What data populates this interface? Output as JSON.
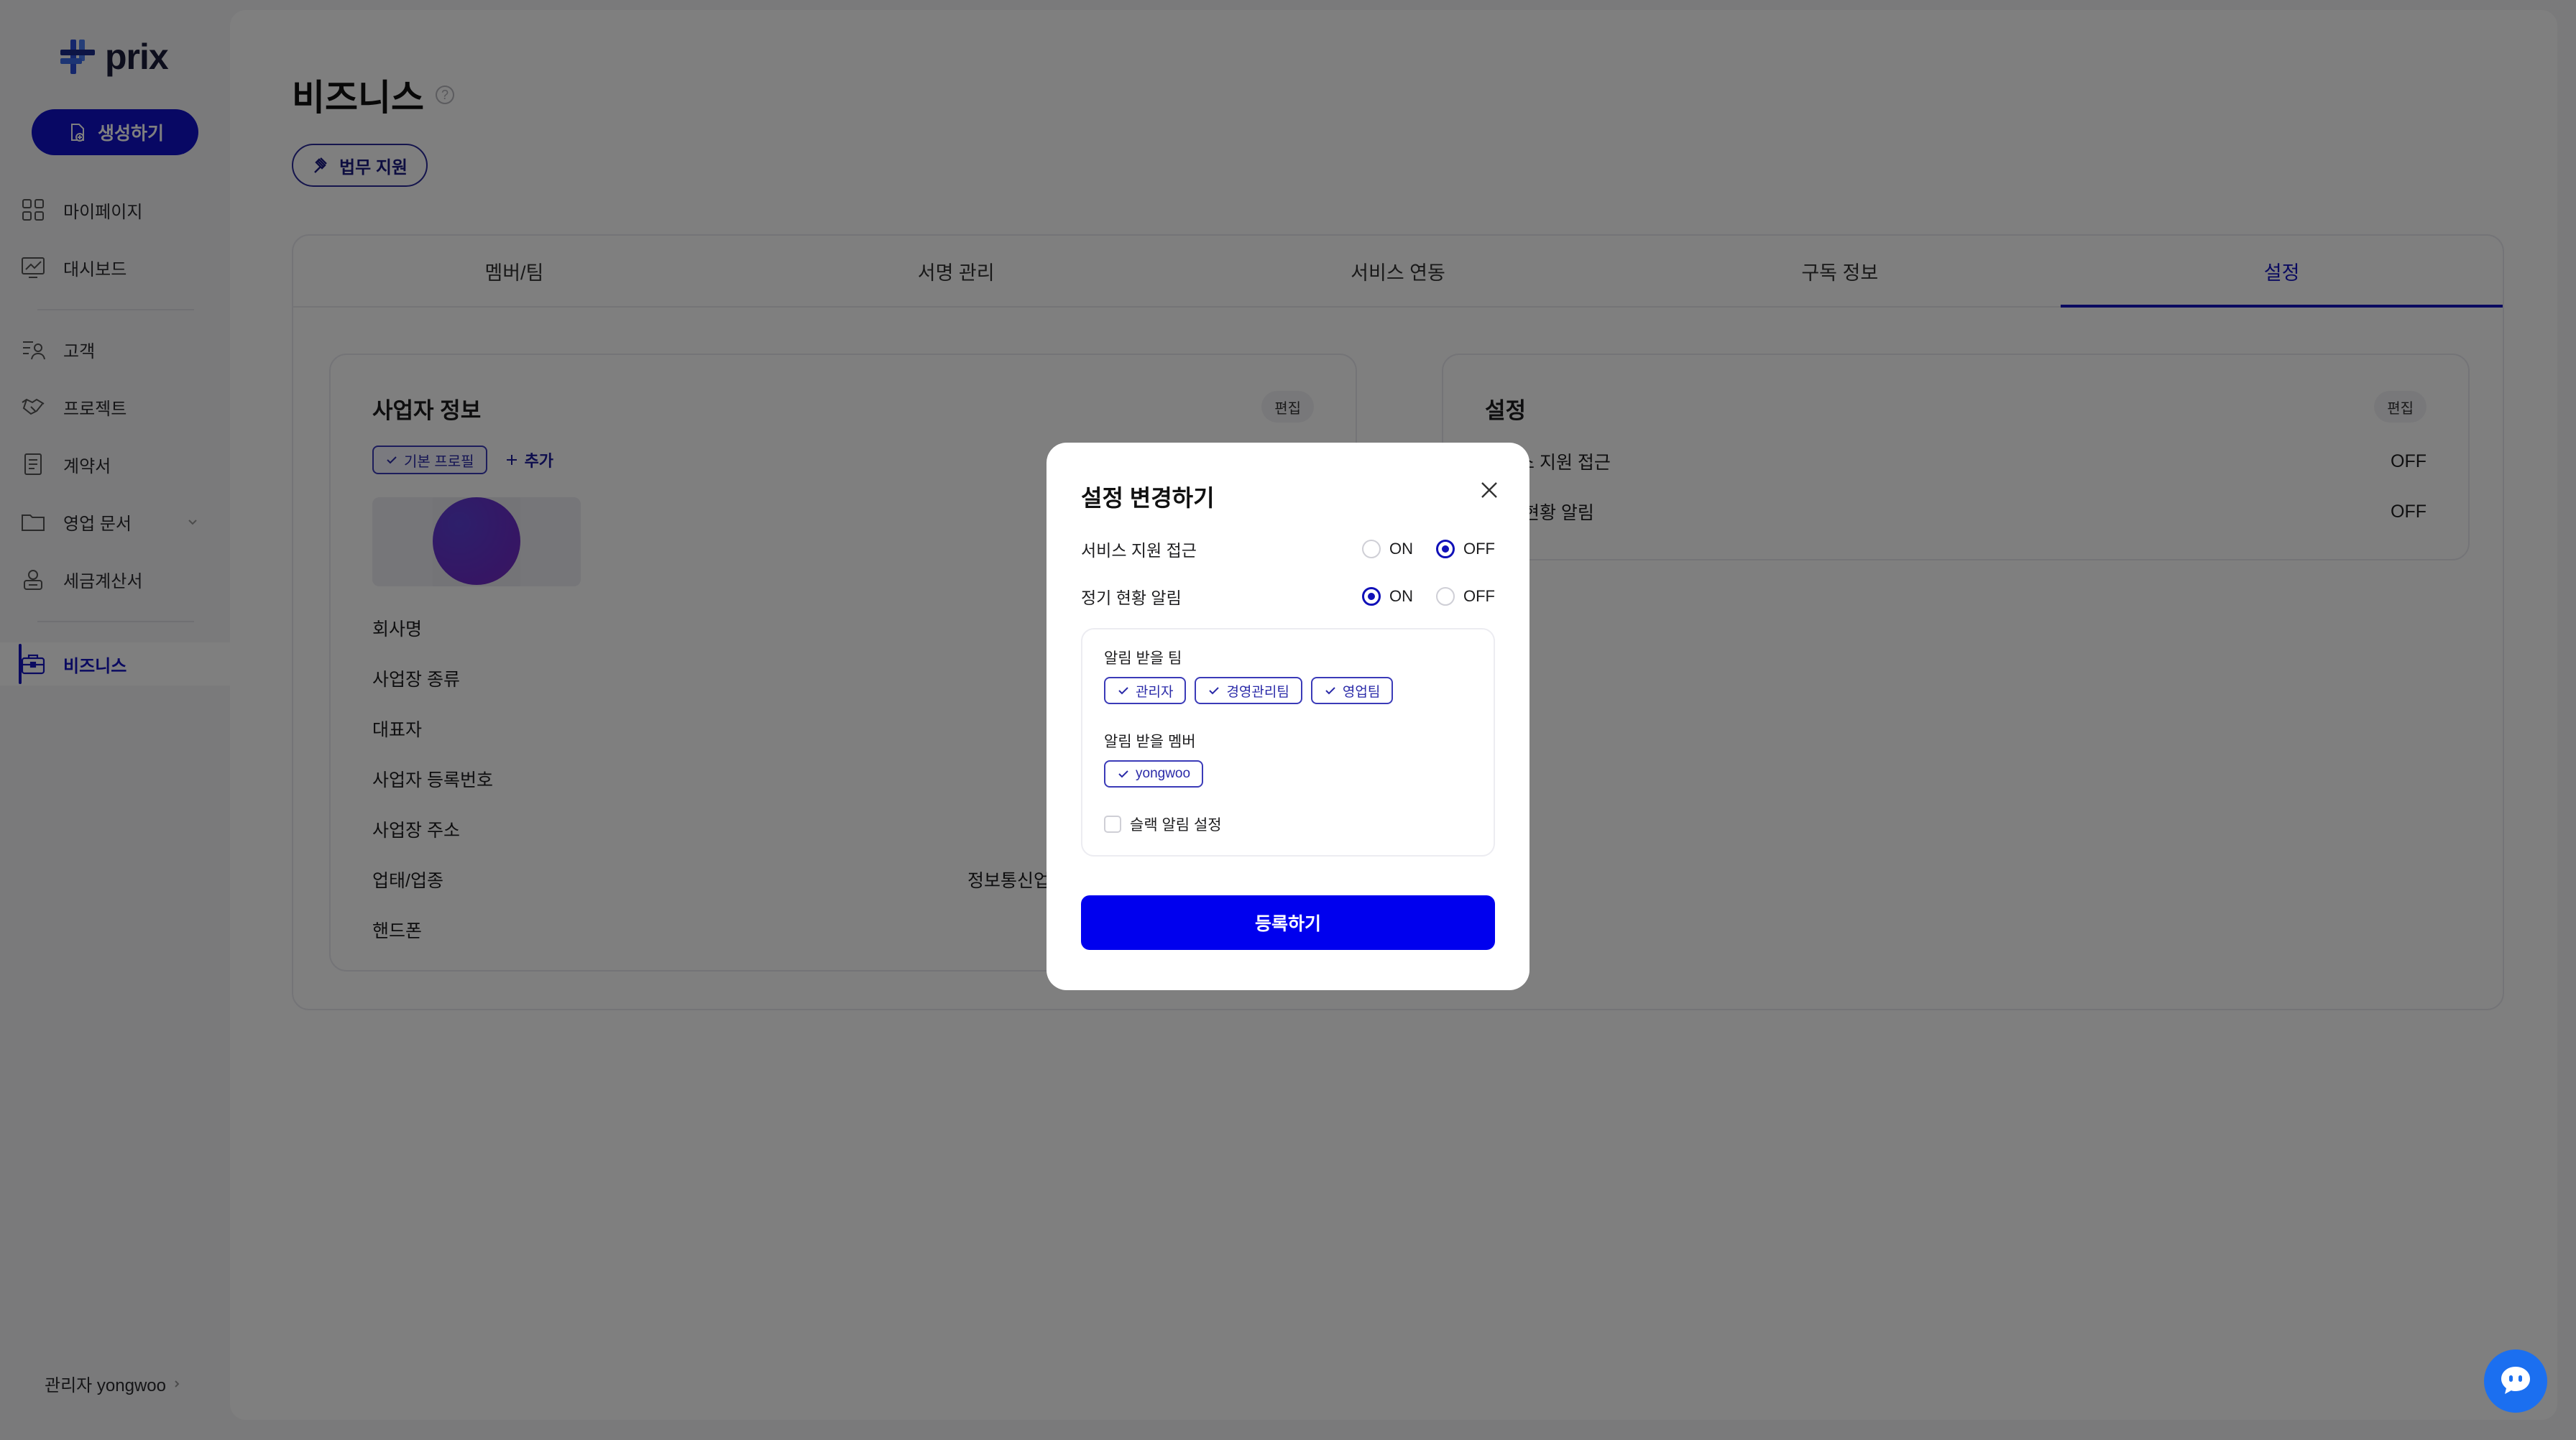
{
  "app": {
    "logo_text": "prix",
    "brand_color": "#1010c8"
  },
  "sidebar": {
    "create_label": "생성하기",
    "items": [
      {
        "label": "마이페이지",
        "icon": "grid-icon"
      },
      {
        "label": "대시보드",
        "icon": "chart-icon"
      },
      {
        "label": "고객",
        "icon": "people-list-icon"
      },
      {
        "label": "프로젝트",
        "icon": "handshake-icon"
      },
      {
        "label": "계약서",
        "icon": "document-icon"
      },
      {
        "label": "영업 문서",
        "icon": "folder-icon"
      },
      {
        "label": "세금계산서",
        "icon": "receipt-icon"
      },
      {
        "label": "비즈니스",
        "icon": "briefcase-icon"
      }
    ],
    "user_label": "관리자 yongwoo"
  },
  "page": {
    "title": "비즈니스",
    "help_symbol": "?",
    "legal_chip": "법무 지원",
    "tabs": [
      "멤버/팀",
      "서명 관리",
      "서비스 연동",
      "구독 정보",
      "설정"
    ],
    "business_card": {
      "title": "사업자 정보",
      "edit_label": "편집",
      "profile_chip": "기본 프로필",
      "add_label": "추가",
      "fields": [
        "회사명",
        "사업장 종류",
        "대표자",
        "사업자 등록번호",
        "사업장 주소",
        "업태/업종",
        "핸드폰"
      ],
      "visible_value": "정보통신업"
    },
    "settings_card": {
      "title": "설정",
      "edit_label": "편집",
      "rows": [
        {
          "label": "서비스 지원 접근",
          "value": "OFF"
        },
        {
          "label": "정기 현황 알림",
          "value": "OFF"
        }
      ]
    }
  },
  "modal": {
    "title": "설정 변경하기",
    "options": [
      {
        "label": "서비스 지원 접근",
        "on_label": "ON",
        "off_label": "OFF",
        "selected": "OFF"
      },
      {
        "label": "정기 현황 알림",
        "on_label": "ON",
        "off_label": "OFF",
        "selected": "ON"
      }
    ],
    "team_label": "알림 받을 팀",
    "teams": [
      "관리자",
      "경영관리팀",
      "영업팀"
    ],
    "member_label": "알림 받을 멤버",
    "members": [
      "yongwoo"
    ],
    "slack_label": "슬랙 알림 설정",
    "submit_label": "등록하기"
  }
}
